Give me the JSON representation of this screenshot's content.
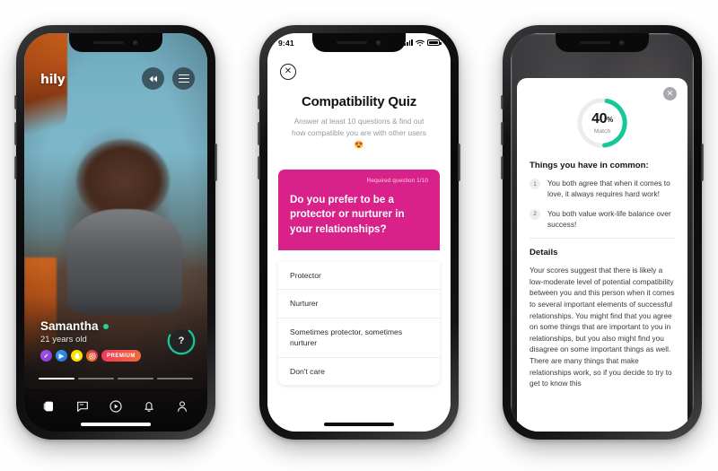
{
  "colors": {
    "pink": "#d9218a",
    "teal": "#16c79a",
    "online_green": "#22d39a",
    "dark": "#0a0a0b"
  },
  "phone1": {
    "name": "profile-card-screen",
    "brand_logo": "hily",
    "icons": {
      "rewind": "rewind-icon",
      "filter": "filter-icon",
      "quiz_fab": "?"
    },
    "profile": {
      "name": "Samantha",
      "age": "21 years old",
      "online": true,
      "badges": [
        {
          "name": "verified-badge",
          "glyph": "✓"
        },
        {
          "name": "video-badge",
          "glyph": "▶"
        },
        {
          "name": "snapchat-badge",
          "glyph": "◔"
        },
        {
          "name": "instagram-badge",
          "glyph": "▢"
        }
      ],
      "premium_label": "PREMIUM"
    },
    "photo_progress": {
      "total": 4,
      "current": 1
    },
    "tabbar": [
      {
        "name": "tab-cards",
        "glyph": "cards-icon",
        "active": true
      },
      {
        "name": "tab-chat",
        "glyph": "chat-icon",
        "active": false
      },
      {
        "name": "tab-stories",
        "glyph": "play-circle-icon",
        "active": false
      },
      {
        "name": "tab-notifications",
        "glyph": "bell-icon",
        "active": false
      },
      {
        "name": "tab-profile",
        "glyph": "person-icon",
        "active": false
      }
    ]
  },
  "phone2": {
    "name": "compatibility-quiz-screen",
    "statusbar": {
      "time": "9:41",
      "signal": "signal-icon",
      "wifi": "wifi-icon",
      "battery": "battery-icon"
    },
    "close_label": "✕",
    "title": "Compatibility Quiz",
    "subtitle": "Answer at least 10 questions & find out how compatible you are with other users 😍",
    "question": {
      "required_label": "Required question 1/10",
      "text": "Do you prefer to be a protector or nurturer in your relationships?"
    },
    "answers": [
      "Protector",
      "Nurturer",
      "Sometimes protector, sometimes nurturer",
      "Don't care"
    ]
  },
  "phone3": {
    "name": "compatibility-result-screen",
    "close_label": "✕",
    "match": {
      "percent": 40,
      "percent_text": "40",
      "percent_symbol": "%",
      "label": "Match"
    },
    "common": {
      "heading": "Things you have in common:",
      "items": [
        {
          "num": "1",
          "text": "You both agree that when it comes to love, it always requires hard work!"
        },
        {
          "num": "2",
          "text": "You both value work-life balance over success!"
        }
      ]
    },
    "details": {
      "heading": "Details",
      "text": "Your scores suggest that there is likely a low-moderate level of potential compatibility between you and this person when it comes to several important elements of successful relationships. You might find that you agree on some things that are important to you in relationships, but you also might find you disagree on some important things as well. There are many things that make relationships work, so if you decide to try to get to know this"
    }
  }
}
